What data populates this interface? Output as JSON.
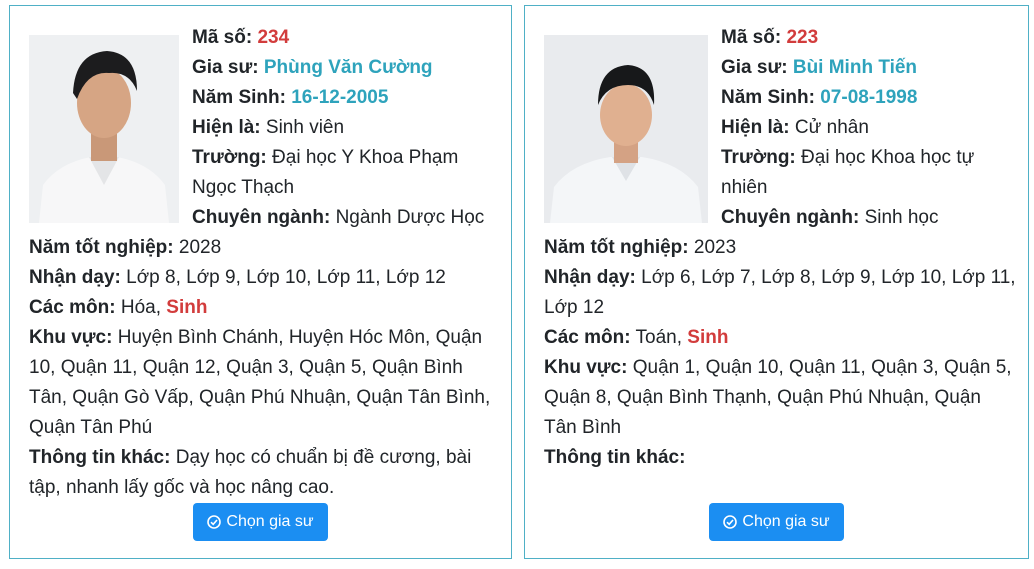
{
  "labels": {
    "code": "Mã số:",
    "tutor": "Gia sư:",
    "birth": "Năm Sinh:",
    "current": "Hiện là:",
    "school": "Trường:",
    "major": "Chuyên ngành:",
    "grad_year": "Năm tốt nghiệp:",
    "teach": "Nhận dạy:",
    "subjects": "Các môn:",
    "area": "Khu vực:",
    "other": "Thông tin khác:",
    "choose_button": "Chọn gia sư"
  },
  "colors": {
    "accent_red": "#d23c3c",
    "accent_teal": "#2ea3bc",
    "button_blue": "#1b8ef2",
    "card_border": "#4fb0c6"
  },
  "tutors": [
    {
      "code": "234",
      "name": "Phùng Văn Cường",
      "birth": "16-12-2005",
      "current": "Sinh viên",
      "school_line1": "Đại học Y Khoa Phạm",
      "school_line2": "Ngọc Thạch",
      "major": "Ngành Dược Học",
      "grad_year": "2028",
      "teach_line1": "Lớp 8, Lớp 9, Lớp 10, Lớp 11, Lớp 12",
      "subjects_plain": "Hóa,",
      "subjects_highlight": "Sinh",
      "area_line1": "Huyện Bình Chánh, Huyện Hóc Môn, Quận",
      "area_line2": "10, Quận 11, Quận 12, Quận 3, Quận 5, Quận Bình",
      "area_line3": "Tân, Quận Gò Vấp, Quận Phú Nhuận, Quận Tân Bình,",
      "area_line4": "Quận Tân Phú",
      "other_line1": "Dạy học có chuẩn bị đề cương, bài",
      "other_line2": "tập, nhanh lấy gốc và học nâng cao."
    },
    {
      "code": "223",
      "name": "Bùi Minh Tiến",
      "birth": "07-08-1998",
      "current": "Cử nhân",
      "school_line1": "Đại học Khoa học tự",
      "school_line2": "nhiên",
      "major": "Sinh học",
      "grad_year": "2023",
      "teach_line1": "Lớp 6, Lớp 7, Lớp 8, Lớp 9, Lớp 10, Lớp 11,",
      "teach_line2": "Lớp 12",
      "subjects_plain": "Toán,",
      "subjects_highlight": "Sinh",
      "area_line1": "Quận 1, Quận 10, Quận 11, Quận 3, Quận 5,",
      "area_line2": "Quận 8, Quận Bình Thạnh, Quận Phú Nhuận, Quận",
      "area_line3": "Tân Bình",
      "other_line1": ""
    }
  ]
}
